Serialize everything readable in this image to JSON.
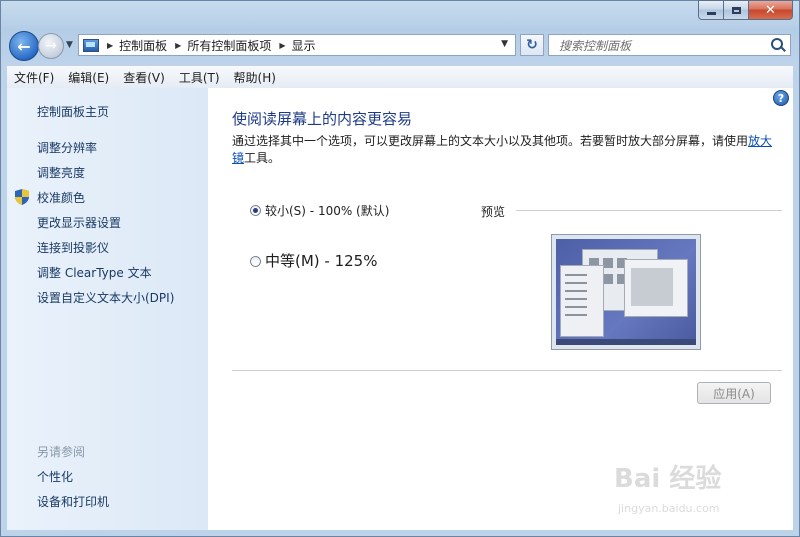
{
  "window": {
    "caption": {
      "close_label": "✕"
    }
  },
  "nav": {
    "breadcrumb": [
      "控制面板",
      "所有控制面板项",
      "显示"
    ],
    "search_placeholder": "搜索控制面板"
  },
  "menu": [
    "文件(F)",
    "编辑(E)",
    "查看(V)",
    "工具(T)",
    "帮助(H)"
  ],
  "sidebar": {
    "home": "控制面板主页",
    "links": [
      "调整分辨率",
      "调整亮度",
      "校准颜色",
      "更改显示器设置",
      "连接到投影仪",
      "调整 ClearType 文本",
      "设置自定义文本大小(DPI)"
    ],
    "see_also_title": "另请参阅",
    "see_also": [
      "个性化",
      "设备和打印机"
    ]
  },
  "main": {
    "title": "使阅读屏幕上的内容更容易",
    "description_before": "通过选择其中一个选项，可以更改屏幕上的文本大小以及其他项。若要暂时放大部分屏幕，请使用",
    "description_link": "放大镜",
    "description_after": "工具。",
    "options": [
      {
        "label": "较小(S) - 100% (默认)",
        "checked": true
      },
      {
        "label": "中等(M) - 125%",
        "checked": false
      }
    ],
    "preview_label": "预览",
    "apply_label": "应用(A)"
  },
  "watermark": {
    "brand": "Bai 经验",
    "url": "jingyan.baidu.com"
  },
  "colors": {
    "accent_title": "#1e3b8a",
    "link": "#0a4fb5",
    "sidebar": "#dbe8f6"
  }
}
